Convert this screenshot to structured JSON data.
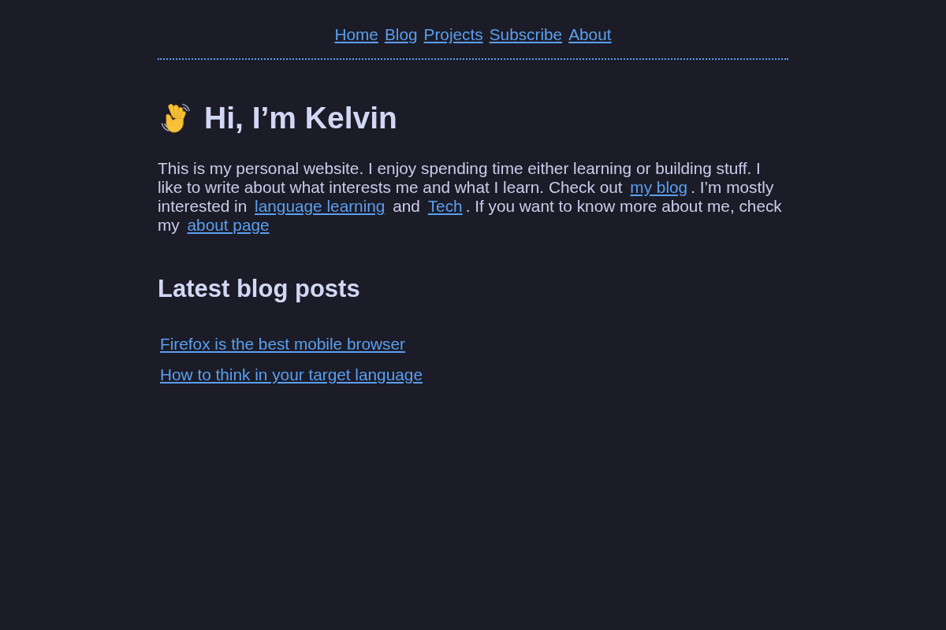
{
  "nav": {
    "links": [
      "Home",
      "Blog",
      "Projects",
      "Subscribe",
      "About"
    ]
  },
  "hero": {
    "title": "Hi, I’m Kelvin",
    "intro": [
      {
        "kind": "text",
        "text": "This is my personal website. I enjoy spending time either learning or building stuff. I like to write about what interests me and what I learn. Check out "
      },
      {
        "kind": "link",
        "text": "my blog"
      },
      {
        "kind": "text",
        "text": ". I’m mostly interested in "
      },
      {
        "kind": "link",
        "text": "language learning"
      },
      {
        "kind": "text",
        "text": " and "
      },
      {
        "kind": "link",
        "text": "Tech"
      },
      {
        "kind": "text",
        "text": ". If you want to know more about me, check my "
      },
      {
        "kind": "link",
        "text": "about page"
      }
    ]
  },
  "latest_posts": {
    "title": "Latest blog posts",
    "posts": [
      "Firefox is the best mobile browser",
      "How to think in your target language"
    ]
  }
}
